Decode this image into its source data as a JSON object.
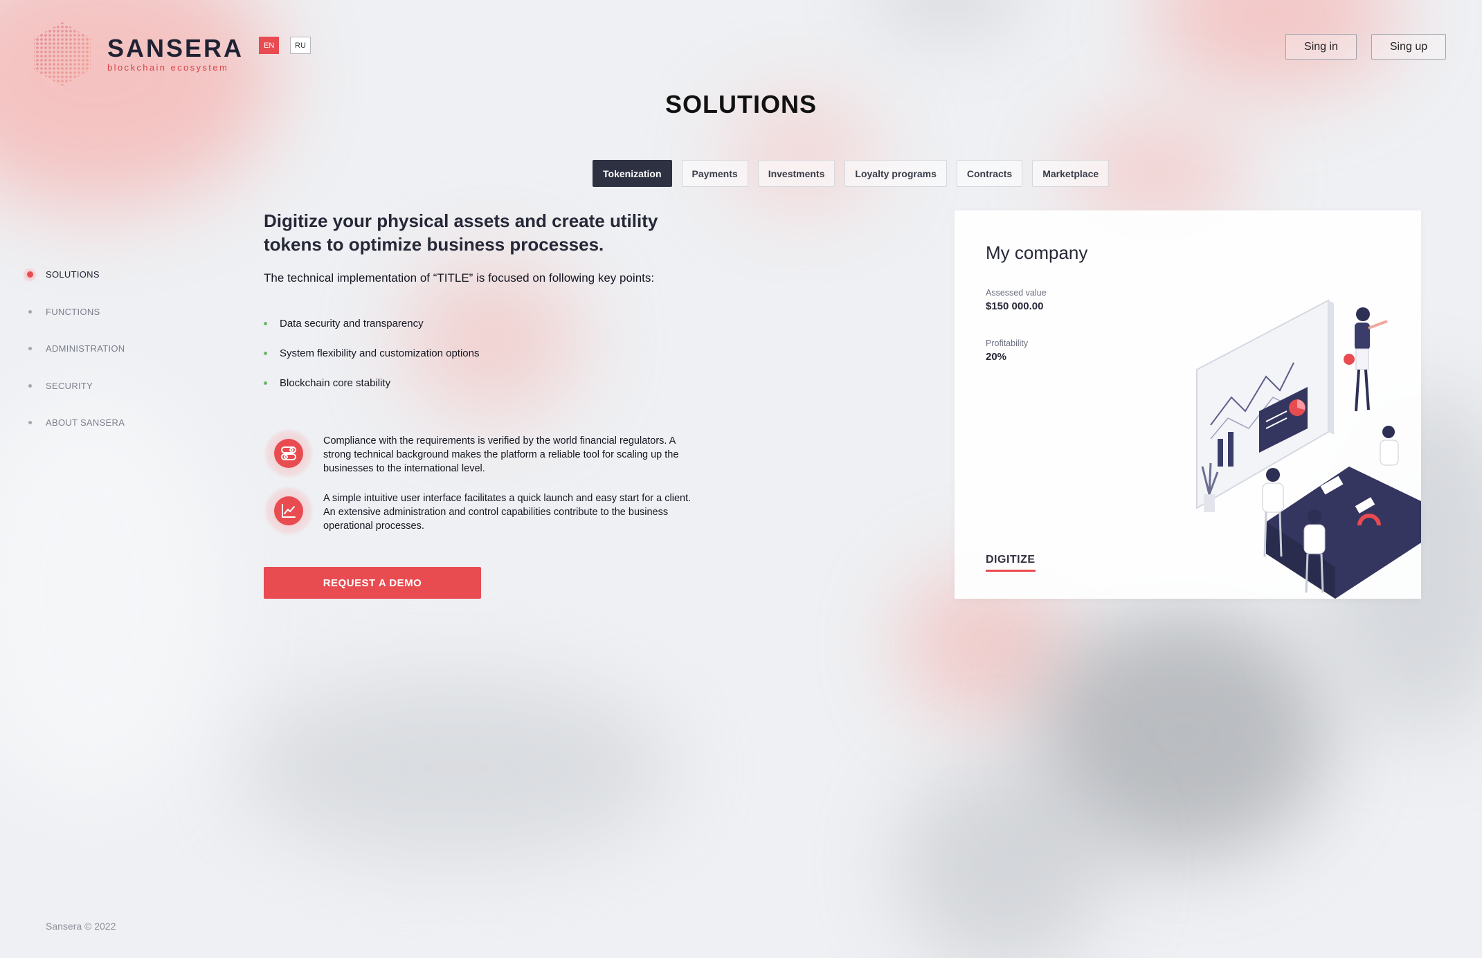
{
  "brand": {
    "name": "SANSERA",
    "tagline": "blockchain ecosystem",
    "accent_color": "#e84b50",
    "dark_color": "#2e3142"
  },
  "languages": [
    {
      "code": "EN",
      "active": true
    },
    {
      "code": "RU",
      "active": false
    }
  ],
  "auth": {
    "signin_label": "Sing in",
    "signup_label": "Sing up"
  },
  "page": {
    "title": "SOLUTIONS"
  },
  "tabs": [
    {
      "label": "Tokenization",
      "active": true
    },
    {
      "label": "Payments",
      "active": false
    },
    {
      "label": "Investments",
      "active": false
    },
    {
      "label": "Loyalty programs",
      "active": false
    },
    {
      "label": "Contracts",
      "active": false
    },
    {
      "label": "Marketplace",
      "active": false
    }
  ],
  "sidenav": [
    {
      "label": "SOLUTIONS",
      "active": true
    },
    {
      "label": "FUNCTIONS",
      "active": false
    },
    {
      "label": "ADMINISTRATION",
      "active": false
    },
    {
      "label": "SECURITY",
      "active": false
    },
    {
      "label": "ABOUT SANSERA",
      "active": false
    }
  ],
  "main": {
    "headline": "Digitize your physical assets and create utility tokens to optimize business processes.",
    "subhead": "The technical implementation of “TITLE” is focused on following key points:",
    "key_points": [
      "Data security and transparency",
      "System flexibility and customization options",
      "Blockchain core stability"
    ],
    "features": [
      {
        "icon": "toggle-switches-icon",
        "text": "Compliance with the requirements is verified by the world financial regulators. A strong technical background makes the platform a reliable tool for scaling up the businesses to the international level."
      },
      {
        "icon": "line-chart-icon",
        "text": "A simple intuitive user interface facilitates a quick launch and easy start for a client. An extensive administration and control capabilities contribute to the business operational processes."
      }
    ],
    "cta_label": "REQUEST A DEMO"
  },
  "card": {
    "title": "My company",
    "assessed_label": "Assessed value",
    "assessed_value": "$150 000.00",
    "profitability_label": "Profitability",
    "profitability_value": "20%",
    "link_label": "DIGITIZE",
    "illustration": "team-meeting-illustration"
  },
  "footer": {
    "copyright": "Sansera © 2022"
  }
}
